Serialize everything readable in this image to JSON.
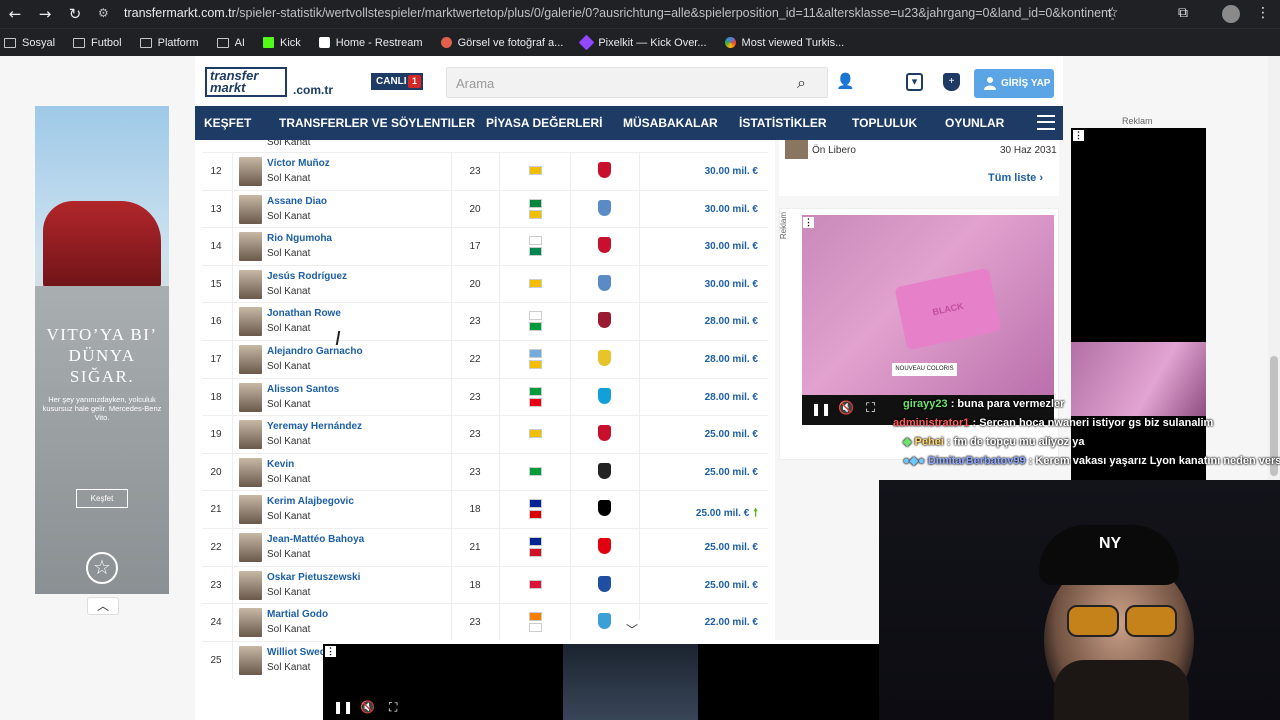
{
  "browser": {
    "url_host": "transfermarkt.com.tr",
    "url_path": "/spieler-statistik/wertvollstespieler/marktwertetop/plus/0/galerie/0?ausrichtung=alle&spielerposition_id=11&altersklasse=u23&jahrgang=0&land_id=0&kontinent_i...",
    "bookmarks": [
      "Sosyal",
      "Futbol",
      "Platform",
      "AI",
      "Kick",
      "Home - Restream",
      "Görsel ve fotoğraf a...",
      "Pixelkit — Kick Over...",
      "Most viewed Turkis..."
    ]
  },
  "left_ad": {
    "headline": "VITO’YA BI’ DÜNYA SIĞAR.",
    "sub": "Her şey yanınızdayken, yolculuk kusursuz hale gelir. Mercedes-Benz Vito.",
    "button": "Keşfet",
    "logo": "☆"
  },
  "header": {
    "logo_line1": "transfer",
    "logo_line2": "markt",
    "domain": ".com.tr",
    "live_label": "CANLI",
    "live_count": "1",
    "search_placeholder": "Arama",
    "login_label": "GİRİŞ YAP"
  },
  "nav": [
    "KEŞFET",
    "TRANSFERLER VE SÖYLENTILER",
    "PİYASA DEĞERLERİ",
    "MÜSABAKALAR",
    "İSTATİSTİKLER",
    "TOPLULUK",
    "OYUNLAR"
  ],
  "table": {
    "partial_top_pos": "Sol Kanat",
    "rows": [
      {
        "no": "12",
        "name": "Víctor Muñoz",
        "pos": "Sol Kanat",
        "age": "23",
        "flags": [
          "#f1bf00"
        ],
        "club": "#c8102e",
        "value": "30.00 mil. €",
        "up": ""
      },
      {
        "no": "13",
        "name": "Assane Diao",
        "pos": "Sol Kanat",
        "age": "20",
        "flags": [
          "#00853f",
          "#f1bf00"
        ],
        "club": "#5b8bc5",
        "value": "30.00 mil. €",
        "up": ""
      },
      {
        "no": "14",
        "name": "Rio Ngumoha",
        "pos": "Sol Kanat",
        "age": "17",
        "flags": [
          "#ffffff",
          "#008751"
        ],
        "club": "#c8102e",
        "value": "30.00 mil. €",
        "up": ""
      },
      {
        "no": "15",
        "name": "Jesús Rodríguez",
        "pos": "Sol Kanat",
        "age": "20",
        "flags": [
          "#f1bf00"
        ],
        "club": "#5b8bc5",
        "value": "30.00 mil. €",
        "up": ""
      },
      {
        "no": "16",
        "name": "Jonathan Rowe",
        "pos": "Sol Kanat",
        "age": "23",
        "flags": [
          "#ffffff",
          "#009b3a"
        ],
        "club": "#9b1b30",
        "value": "28.00 mil. €",
        "up": ""
      },
      {
        "no": "17",
        "name": "Alejandro Garnacho",
        "pos": "Sol Kanat",
        "age": "22",
        "flags": [
          "#74acdf",
          "#f1bf00"
        ],
        "club": "#e8c32a",
        "value": "28.00 mil. €",
        "up": ""
      },
      {
        "no": "18",
        "name": "Alisson Santos",
        "pos": "Sol Kanat",
        "age": "23",
        "flags": [
          "#009c3b",
          "#e70013"
        ],
        "club": "#12a0d7",
        "value": "28.00 mil. €",
        "up": ""
      },
      {
        "no": "19",
        "name": "Yeremay Hernández",
        "pos": "Sol Kanat",
        "age": "23",
        "flags": [
          "#f1bf00"
        ],
        "club": "#c8102e",
        "value": "25.00 mil. €",
        "up": ""
      },
      {
        "no": "20",
        "name": "Kevin",
        "pos": "Sol Kanat",
        "age": "23",
        "flags": [
          "#009c3b"
        ],
        "club": "#222222",
        "value": "25.00 mil. €",
        "up": ""
      },
      {
        "no": "21",
        "name": "Kerim Alajbegovic",
        "pos": "Sol Kanat",
        "age": "18",
        "flags": [
          "#002395",
          "#dd0000"
        ],
        "club": "#000000",
        "value": "25.00 mil. €",
        "up": "🠕"
      },
      {
        "no": "22",
        "name": "Jean-Mattéo Bahoya",
        "pos": "Sol Kanat",
        "age": "21",
        "flags": [
          "#002395",
          "#ce1126"
        ],
        "club": "#e1000f",
        "value": "25.00 mil. €",
        "up": ""
      },
      {
        "no": "23",
        "name": "Oskar Pietuszewski",
        "pos": "Sol Kanat",
        "age": "18",
        "flags": [
          "#dc143c"
        ],
        "club": "#1f4fa0",
        "value": "25.00 mil. €",
        "up": ""
      },
      {
        "no": "24",
        "name": "Martial Godo",
        "pos": "Sol Kanat",
        "age": "23",
        "flags": [
          "#f77f00",
          "#ffffff"
        ],
        "club": "#3aa0d5",
        "value": "22.00 mil. €",
        "up": ""
      },
      {
        "no": "25",
        "name": "Williot Swedberg",
        "pos": "Sol Kanat",
        "age": "",
        "flags": [],
        "club": "",
        "value": "",
        "up": ""
      }
    ]
  },
  "sidebar": {
    "mini_pos": "Ön Libero",
    "mini_date": "30 Haz 2031",
    "all_list": "Tüm liste ›",
    "ad_label": "Reklam",
    "video_product": "BLACK",
    "video_tag": "NOUVEAU COLORIS"
  },
  "right_ad_label": "Reklam",
  "chat": [
    {
      "user": "girayy23",
      "msg": " : buna para vermezler"
    },
    {
      "user": "administrator1",
      "msg": " : Sercan hoca nwaneri istiyor gs biz sulanalim"
    },
    {
      "user": "Pehei",
      "msg": " : fm de topçu mu aliyoz ya"
    },
    {
      "user": "DimitarBerbatov99",
      "msg": " : Kerem vakası yaşarız Lyon kanatını neden versin"
    }
  ],
  "webcam": {
    "cap_logo": "NY"
  },
  "colors": {
    "navy": "#1d3b64",
    "link": "#1d5fa6",
    "login": "#5ba4e6",
    "live_badge": "#d62727"
  }
}
